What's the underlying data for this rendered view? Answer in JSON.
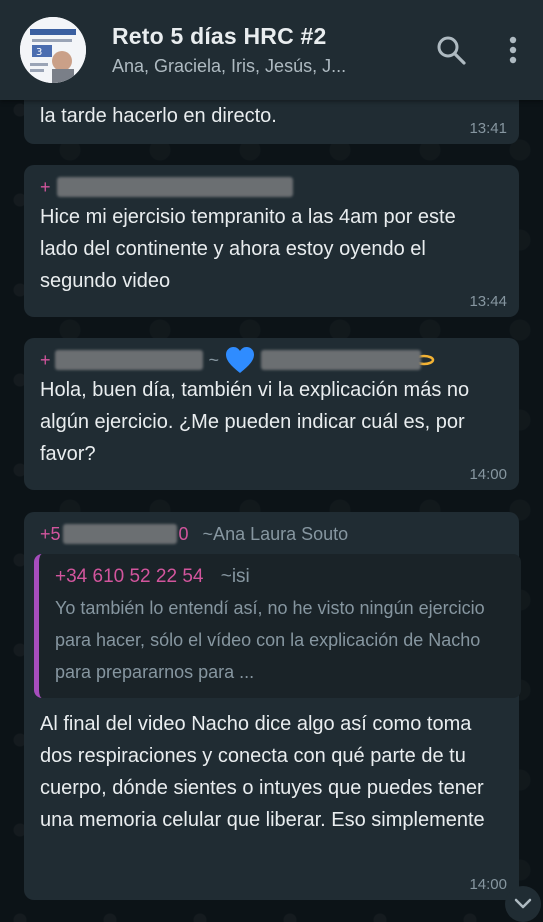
{
  "header": {
    "title": "Reto 5 días HRC #2",
    "members": "Ana, Graciela, Iris, Jesús, J...",
    "avatar_icon": "group-avatar-icon",
    "search_icon": "search-icon",
    "menu_icon": "more-vertical-icon"
  },
  "messages": [
    {
      "text": "la tarde hacerlo en directo.",
      "time": "13:41"
    },
    {
      "sender_prefix": "+",
      "sender_suffix": "",
      "text": "Hice mi ejercisio tempranito a las 4am por este lado del continente y ahora estoy oyendo el segundo video",
      "time": "13:44"
    },
    {
      "sender_prefix": "+",
      "sender_name": "~",
      "text": "Hola, buen día, también vi la explicación más no algún ejercicio. ¿Me pueden indicar cuál es, por favor?",
      "time": "14:00"
    },
    {
      "sender_prefix": "+5",
      "sender_suffix": "0",
      "sender_name": "~Ana Laura Souto",
      "quote": {
        "phone": "+34 610 52 22 54",
        "name": "~isi",
        "text": "Yo también lo entendí así, no he visto ningún ejercicio para hacer, sólo el vídeo con la explicación de Nacho para prepararnos para ..."
      },
      "text": "Al final del video Nacho dice algo así como toma dos respiraciones y conecta con qué parte de tu cuerpo, dónde sientes o intuyes que puedes tener una memoria celular que liberar. Eso simplemente",
      "time": "14:00"
    }
  ],
  "colors": {
    "header_bg": "#202c33",
    "bubble_bg": "#202c33",
    "chat_bg": "#0b141a",
    "sender_phone": "#d2559d",
    "quote_bar": "#a64dbd",
    "meta_text": "#8696a0"
  }
}
